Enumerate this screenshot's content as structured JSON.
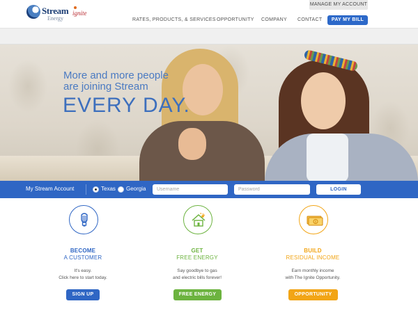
{
  "header": {
    "logo_word": "Stream",
    "logo_sub": "Energy",
    "partner_logo": "ignite",
    "manage_account": "MANAGE MY ACCOUNT",
    "nav": [
      "RATES, PRODUCTS, & SERVICES",
      "OPPORTUNITY",
      "COMPANY",
      "CONTACT"
    ],
    "pay_bill": "PAY MY BILL"
  },
  "hero": {
    "line1": "More and more people",
    "line2": "are joining Stream",
    "line3": "EVERY DAY."
  },
  "login": {
    "title": "My Stream Account",
    "states": [
      "Texas",
      "Georgia"
    ],
    "selected_state": "Texas",
    "username_placeholder": "Username",
    "password_placeholder": "Password",
    "button": "LOGIN"
  },
  "features": [
    {
      "icon": "lightbulb-icon",
      "title": "BECOME",
      "subtitle": "A CUSTOMER",
      "desc_line1": "It's easy.",
      "desc_line2": "Click here to start today.",
      "button": "SIGN UP",
      "color": "#2f66c4"
    },
    {
      "icon": "house-icon",
      "title": "GET",
      "subtitle": "FREE ENERGY",
      "desc_line1": "Say goodbye to gas",
      "desc_line2": "and electric bills forever!",
      "button": "FREE ENERGY",
      "color": "#6cb33f"
    },
    {
      "icon": "money-icon",
      "title": "BUILD",
      "subtitle": "RESIDUAL INCOME",
      "desc_line1": "Earn monthly income",
      "desc_line2": "with The Ignite Opportunity.",
      "button": "OPPORTUNITY",
      "color": "#f2a516"
    }
  ],
  "colors": {
    "brand_blue": "#2f66c4",
    "green": "#6cb33f",
    "orange": "#f2a516"
  }
}
